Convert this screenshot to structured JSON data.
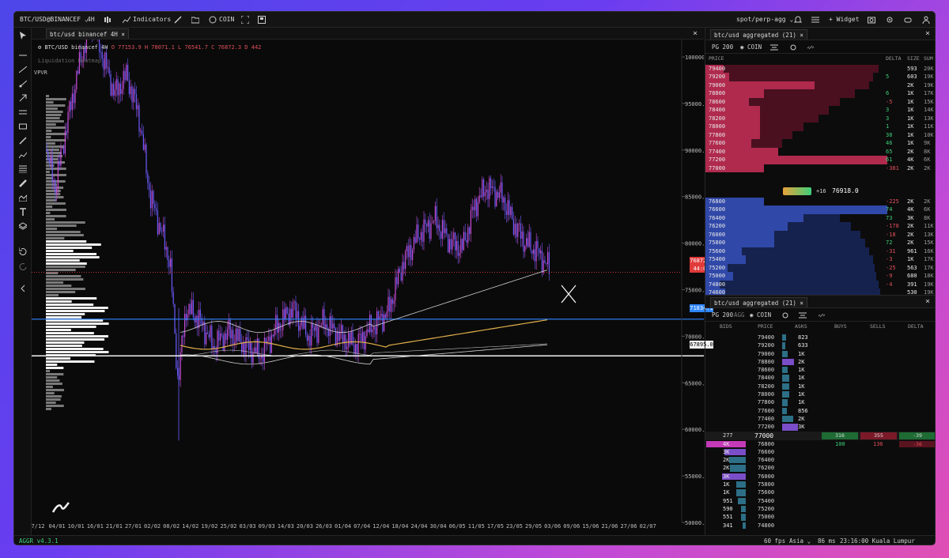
{
  "topbar": {
    "symbol": "BTC/USD@BINANCEF",
    "timeframe": "4H",
    "indicators_label": "Indicators",
    "coin_label": "COIN",
    "market_label": "spot/perp-agg",
    "widget_label": "Widget"
  },
  "chart": {
    "tab_title": "btc/usd binancef 4H",
    "legend_symbol": "BTC/USD binancef 4H",
    "legend_ohlc": "O 77153.9  H 78071.1  L 76541.7  C 76872.3  D 442",
    "heatmap_label": "Liquidation Heatmap",
    "vpvr_label": "VPVR",
    "price_ticks": [
      "100000.0",
      "95000.0",
      "90000.0",
      "85000.0",
      "80000.0",
      "75000.0",
      "70000.0",
      "65000.0",
      "60000.0",
      "55000.0",
      "50000.0"
    ],
    "date_ticks": [
      "7/12",
      "04/01",
      "10/01",
      "16/01",
      "21/01",
      "27/01",
      "02/02",
      "08/02",
      "14/02",
      "19/02",
      "25/02",
      "03/03",
      "09/03",
      "14/03",
      "20/03",
      "26/03",
      "01/04",
      "07/04",
      "12/04",
      "18/04",
      "24/04",
      "30/04",
      "06/05",
      "11/05",
      "17/05",
      "23/05",
      "29/05",
      "03/06",
      "09/06",
      "15/06",
      "21/06",
      "27/06",
      "02/07"
    ],
    "price_badge": "76872.3",
    "countdown_badge": "44:00",
    "level_blue": "71834.1",
    "level_white": "67895.0",
    "colors": {
      "up": "#c94bd6",
      "down": "#6a5cff",
      "level_blue": "#2e86ff",
      "vwap": "#e2b04a",
      "band": "#d0d0d0",
      "last": "#e03a3a"
    }
  },
  "book1": {
    "tab_title": "btc/usd aggregated (21)",
    "pg_label": "PG 200",
    "coin_label": "COIN",
    "headers": {
      "price": "PRICE",
      "delta": "DELTA",
      "size": "SIZE",
      "sum": "SUM"
    },
    "asks": [
      {
        "price": "79400",
        "delta": "",
        "size": "593",
        "sum": "20K",
        "w": 0.1,
        "cw": 0.95
      },
      {
        "price": "79200",
        "delta": "5",
        "size": "603",
        "sum": "19K",
        "w": 0.13,
        "cw": 0.92
      },
      {
        "price": "79000",
        "delta": "",
        "size": "2K",
        "sum": "19K",
        "w": 0.6,
        "cw": 0.9
      },
      {
        "price": "78800",
        "delta": "6",
        "size": "1K",
        "sum": "17K",
        "w": 0.32,
        "cw": 0.82
      },
      {
        "price": "78600",
        "delta": "-5",
        "size": "1K",
        "sum": "15K",
        "w": 0.24,
        "cw": 0.74
      },
      {
        "price": "78400",
        "delta": "3",
        "size": "1K",
        "sum": "14K",
        "w": 0.3,
        "cw": 0.68
      },
      {
        "price": "78200",
        "delta": "3",
        "size": "1K",
        "sum": "13K",
        "w": 0.3,
        "cw": 0.62
      },
      {
        "price": "78000",
        "delta": "1",
        "size": "1K",
        "sum": "11K",
        "w": 0.3,
        "cw": 0.54
      },
      {
        "price": "77800",
        "delta": "38",
        "size": "1K",
        "sum": "10K",
        "w": 0.3,
        "cw": 0.48
      },
      {
        "price": "77600",
        "delta": "46",
        "size": "1K",
        "sum": "9K",
        "w": 0.25,
        "cw": 0.42
      },
      {
        "price": "77400",
        "delta": "65",
        "size": "2K",
        "sum": "8K",
        "w": 0.4,
        "cw": 0.38
      },
      {
        "price": "77200",
        "delta": "61",
        "size": "4K",
        "sum": "6K",
        "w": 1.0,
        "cw": 1.0
      },
      {
        "price": "77000",
        "delta": "-381",
        "size": "2K",
        "sum": "2K",
        "w": 0.32,
        "cw": 0.32
      }
    ],
    "mid_delta": "+16",
    "mid_price": "76918.0",
    "bids": [
      {
        "price": "76800",
        "delta": "-225",
        "size": "2K",
        "sum": "2K",
        "w": 0.32,
        "cw": 0.32
      },
      {
        "price": "76600",
        "delta": "74",
        "size": "4K",
        "sum": "6K",
        "w": 1.0,
        "cw": 1.0
      },
      {
        "price": "76400",
        "delta": "73",
        "size": "3K",
        "sum": "8K",
        "w": 0.54,
        "cw": 0.74
      },
      {
        "price": "76200",
        "delta": "-178",
        "size": "2K",
        "sum": "11K",
        "w": 0.45,
        "cw": 0.8
      },
      {
        "price": "76000",
        "delta": "-18",
        "size": "2K",
        "sum": "13K",
        "w": 0.38,
        "cw": 0.85
      },
      {
        "price": "75800",
        "delta": "72",
        "size": "2K",
        "sum": "15K",
        "w": 0.38,
        "cw": 0.88
      },
      {
        "price": "75600",
        "delta": "-31",
        "size": "961",
        "sum": "16K",
        "w": 0.2,
        "cw": 0.9
      },
      {
        "price": "75400",
        "delta": "-3",
        "size": "1K",
        "sum": "17K",
        "w": 0.22,
        "cw": 0.92
      },
      {
        "price": "75200",
        "delta": "-25",
        "size": "563",
        "sum": "17K",
        "w": 0.12,
        "cw": 0.93
      },
      {
        "price": "75000",
        "delta": "-9",
        "size": "680",
        "sum": "18K",
        "w": 0.15,
        "cw": 0.94
      },
      {
        "price": "74800",
        "delta": "-4",
        "size": "391",
        "sum": "19K",
        "w": 0.08,
        "cw": 0.95
      },
      {
        "price": "74600",
        "delta": "",
        "size": "530",
        "sum": "19K",
        "w": 0.11,
        "cw": 0.96
      },
      {
        "price": "74400",
        "delta": "",
        "size": "632",
        "sum": "20K",
        "w": 0.13,
        "cw": 0.97
      }
    ]
  },
  "book2": {
    "tab_title": "btc/usd aggregated (21)",
    "pg_label": "PG 200",
    "agg_label": "AGG",
    "coin_label": "COIN",
    "headers": {
      "bids": "BIDS",
      "price": "PRICE",
      "asks": "ASKS",
      "buys": "BUYS",
      "sells": "SELLS",
      "delta": "DELTA"
    },
    "asks": [
      {
        "price": "79400",
        "size": "823",
        "w": 0.16
      },
      {
        "price": "79200",
        "size": "633",
        "w": 0.13
      },
      {
        "price": "79000",
        "size": "1K",
        "w": 0.22
      },
      {
        "price": "78800",
        "size": "2K",
        "w": 0.45
      },
      {
        "price": "78600",
        "size": "1K",
        "w": 0.22
      },
      {
        "price": "78400",
        "size": "1K",
        "w": 0.26
      },
      {
        "price": "78200",
        "size": "1K",
        "w": 0.26
      },
      {
        "price": "78000",
        "size": "1K",
        "w": 0.26
      },
      {
        "price": "77800",
        "size": "1K",
        "w": 0.22
      },
      {
        "price": "77600",
        "size": "856",
        "w": 0.17
      },
      {
        "price": "77400",
        "size": "2K",
        "w": 0.4
      },
      {
        "price": "77200",
        "size": "3K",
        "w": 0.6
      }
    ],
    "spread": {
      "bid": "277",
      "price": "77000",
      "buys": "316",
      "sells": "355",
      "delta": "-39"
    },
    "trade_row": {
      "price": "76800",
      "buys": "100",
      "sells": "136",
      "delta": "-36"
    },
    "bids": [
      {
        "price": "76800",
        "size": "4K",
        "w": 1.0
      },
      {
        "price": "76600",
        "size": "3K",
        "w": 0.55
      },
      {
        "price": "76400",
        "size": "2K",
        "w": 0.42
      },
      {
        "price": "76200",
        "size": "2K",
        "w": 0.4
      },
      {
        "price": "76000",
        "size": "3K",
        "w": 0.6
      },
      {
        "price": "75800",
        "size": "1K",
        "w": 0.24
      },
      {
        "price": "75600",
        "size": "1K",
        "w": 0.25
      },
      {
        "price": "75400",
        "size": "951",
        "w": 0.2
      },
      {
        "price": "75200",
        "size": "590",
        "w": 0.13
      },
      {
        "price": "75000",
        "size": "551",
        "w": 0.12
      },
      {
        "price": "74800",
        "size": "341",
        "w": 0.08
      }
    ]
  },
  "statusbar": {
    "version": "AGGR v4.3.1",
    "fps": "60 fps",
    "exchange": "Asia",
    "latency": "86 ms",
    "clock": "23:16:00 Kuala Lumpur (UTC+8)"
  }
}
